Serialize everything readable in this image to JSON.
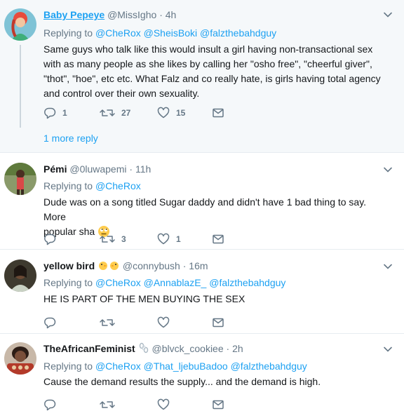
{
  "tweets": [
    {
      "name": "Baby Pepeye",
      "handle": "@MissIgho",
      "time": "4h",
      "replying_label": "Replying to",
      "mentions": [
        "@CheRox",
        "@SheisBoki",
        "@falzthebahdguy"
      ],
      "text": "Same guys who talk like this would insult a girl having non-transactional sex with as many people as she likes by calling her \"osho free\", \"cheerful giver\", \"thot\", \"hoe\", etc etc.  What Falz and co really hate, is girls having total agency and control over their own sexuality.",
      "reply_count": "1",
      "retweet_count": "27",
      "like_count": "15",
      "more_replies": "1 more reply"
    },
    {
      "name": "Pémi",
      "handle": "@0luwapemi",
      "time": "11h",
      "replying_label": "Replying to",
      "mentions": [
        "@CheRox"
      ],
      "text_line1": "Dude was on a song titled Sugar daddy and didn't have 1 bad thing to say. More",
      "text_line2": "popular sha",
      "reply_count": "",
      "retweet_count": "3",
      "like_count": "1"
    },
    {
      "name": "yellow bird",
      "handle": "@connybush",
      "time": "16m",
      "replying_label": "Replying to",
      "mentions": [
        "@CheRox",
        "@AnnablazE_",
        "@falzthebahdguy"
      ],
      "text": "HE IS PART OF THE MEN BUYING THE SEX",
      "reply_count": "",
      "retweet_count": "",
      "like_count": ""
    },
    {
      "name": "TheAfricanFeminist",
      "handle": "@blvck_cookiee",
      "time": "2h",
      "replying_label": "Replying to",
      "mentions": [
        "@CheRox",
        "@That_ljebuBadoo",
        "@falzthebahdguy"
      ],
      "text": "Cause the demand results the supply... and the demand is high.",
      "reply_count": "",
      "retweet_count": "",
      "like_count": ""
    }
  ],
  "separator": "·",
  "colors": {
    "accent": "#1da1f2",
    "muted": "#657786",
    "highlight_bg": "#f5f8fa",
    "border": "#e6ecf0"
  },
  "icons": [
    "reply-icon",
    "retweet-icon",
    "like-icon",
    "message-icon",
    "chevron-down-icon"
  ]
}
